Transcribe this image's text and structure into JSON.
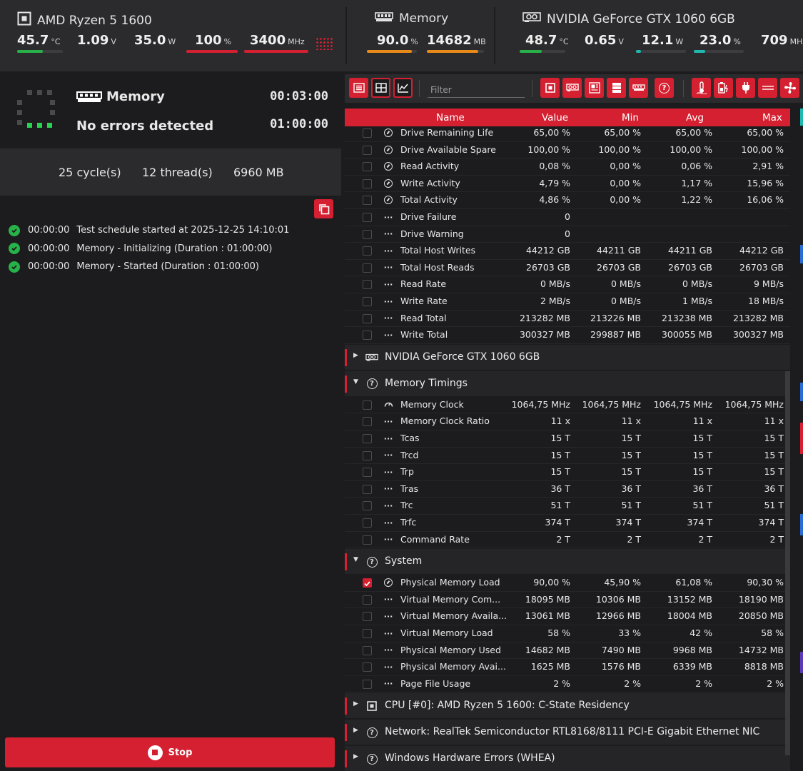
{
  "topbar": {
    "cpu": {
      "title": "AMD Ryzen 5 1600",
      "metrics": [
        {
          "value": "45.7",
          "unit": "°C",
          "fill": 0.57,
          "color": "#27b249"
        },
        {
          "value": "1.09",
          "unit": "V"
        },
        {
          "value": "35.0",
          "unit": "W"
        },
        {
          "value": "100",
          "unit": "%",
          "fill": 1.0,
          "color": "#d42030"
        },
        {
          "value": "3400",
          "unit": "MHz",
          "fill": 1.0,
          "color": "#d42030"
        }
      ]
    },
    "memory": {
      "title": "Memory",
      "metrics": [
        {
          "value": "90.0",
          "unit": "%",
          "fill": 0.9,
          "color": "#e88a1a"
        },
        {
          "value": "14682",
          "unit": "MB",
          "fill": 0.9,
          "color": "#e88a1a"
        }
      ]
    },
    "gpu": {
      "title": "NVIDIA GeForce GTX 1060 6GB",
      "metrics": [
        {
          "value": "48.7",
          "unit": "°C",
          "fill": 0.49,
          "color": "#27b249"
        },
        {
          "value": "0.65",
          "unit": "V"
        },
        {
          "value": "12.1",
          "unit": "W",
          "fill": 0.1,
          "color": "#1fb8b0"
        },
        {
          "value": "23.0",
          "unit": "%",
          "fill": 0.23,
          "color": "#1fb8b0"
        },
        {
          "value": "709",
          "unit": "MHz"
        }
      ]
    }
  },
  "status": {
    "title": "Memory",
    "subtitle": "No errors detected",
    "elapsed": "00:03:00",
    "duration": "01:00:00"
  },
  "summary": {
    "cycles": "25 cycle(s)",
    "threads": "12 thread(s)",
    "memory": "6960 MB"
  },
  "log": [
    {
      "time": "00:00:00",
      "text": "Test schedule started at 2025-12-25 14:10:01"
    },
    {
      "time": "00:00:00",
      "text": "Memory - Initializing (Duration : 01:00:00)"
    },
    {
      "time": "00:00:00",
      "text": "Memory - Started (Duration : 01:00:00)"
    }
  ],
  "stop_label": "Stop",
  "toolbar": {
    "filter_placeholder": "Filter"
  },
  "columns": {
    "name": "Name",
    "value": "Value",
    "min": "Min",
    "avg": "Avg",
    "max": "Max"
  },
  "grid": [
    {
      "type": "row",
      "icon": "gauge",
      "name": "Drive Remaining Life",
      "value": "65,00 %",
      "min": "65,00 %",
      "avg": "65,00 %",
      "max": "65,00 %"
    },
    {
      "type": "row",
      "icon": "gauge",
      "name": "Drive Available Spare",
      "value": "100,00 %",
      "min": "100,00 %",
      "avg": "100,00 %",
      "max": "100,00 %"
    },
    {
      "type": "row",
      "icon": "gauge",
      "name": "Read Activity",
      "value": "0,08 %",
      "min": "0,00 %",
      "avg": "0,06 %",
      "max": "2,91 %"
    },
    {
      "type": "row",
      "icon": "gauge",
      "name": "Write Activity",
      "value": "4,79 %",
      "min": "0,00 %",
      "avg": "1,17 %",
      "max": "15,96 %"
    },
    {
      "type": "row",
      "icon": "gauge",
      "name": "Total Activity",
      "value": "4,86 %",
      "min": "0,00 %",
      "avg": "1,22 %",
      "max": "16,06 %"
    },
    {
      "type": "row",
      "icon": "dots",
      "name": "Drive Failure",
      "value": "0",
      "min": "",
      "avg": "",
      "max": ""
    },
    {
      "type": "row",
      "icon": "dots",
      "name": "Drive Warning",
      "value": "0",
      "min": "",
      "avg": "",
      "max": ""
    },
    {
      "type": "row",
      "icon": "dots",
      "name": "Total Host Writes",
      "value": "44212 GB",
      "min": "44211 GB",
      "avg": "44211 GB",
      "max": "44212 GB"
    },
    {
      "type": "row",
      "icon": "dots",
      "name": "Total Host Reads",
      "value": "26703 GB",
      "min": "26703 GB",
      "avg": "26703 GB",
      "max": "26703 GB"
    },
    {
      "type": "row",
      "icon": "dots",
      "name": "Read Rate",
      "value": "0 MB/s",
      "min": "0 MB/s",
      "avg": "0 MB/s",
      "max": "9 MB/s"
    },
    {
      "type": "row",
      "icon": "dots",
      "name": "Write Rate",
      "value": "2 MB/s",
      "min": "0 MB/s",
      "avg": "1 MB/s",
      "max": "18 MB/s"
    },
    {
      "type": "row",
      "icon": "dots",
      "name": "Read Total",
      "value": "213282 MB",
      "min": "213226 MB",
      "avg": "213238 MB",
      "max": "213282 MB"
    },
    {
      "type": "row",
      "icon": "dots",
      "name": "Write Total",
      "value": "300327 MB",
      "min": "299887 MB",
      "avg": "300055 MB",
      "max": "300327 MB"
    },
    {
      "type": "group",
      "icon": "gpu",
      "name": "NVIDIA GeForce GTX 1060 6GB",
      "expanded": false
    },
    {
      "type": "group",
      "icon": "question",
      "name": "Memory Timings",
      "expanded": true
    },
    {
      "type": "row",
      "icon": "speed",
      "name": "Memory Clock",
      "value": "1064,75 MHz",
      "min": "1064,75 MHz",
      "avg": "1064,75 MHz",
      "max": "1064,75 MHz"
    },
    {
      "type": "row",
      "icon": "dots",
      "name": "Memory Clock Ratio",
      "value": "11 x",
      "min": "11 x",
      "avg": "11 x",
      "max": "11 x"
    },
    {
      "type": "row",
      "icon": "dots",
      "name": "Tcas",
      "value": "15 T",
      "min": "15 T",
      "avg": "15 T",
      "max": "15 T"
    },
    {
      "type": "row",
      "icon": "dots",
      "name": "Trcd",
      "value": "15 T",
      "min": "15 T",
      "avg": "15 T",
      "max": "15 T"
    },
    {
      "type": "row",
      "icon": "dots",
      "name": "Trp",
      "value": "15 T",
      "min": "15 T",
      "avg": "15 T",
      "max": "15 T"
    },
    {
      "type": "row",
      "icon": "dots",
      "name": "Tras",
      "value": "36 T",
      "min": "36 T",
      "avg": "36 T",
      "max": "36 T"
    },
    {
      "type": "row",
      "icon": "dots",
      "name": "Trc",
      "value": "51 T",
      "min": "51 T",
      "avg": "51 T",
      "max": "51 T"
    },
    {
      "type": "row",
      "icon": "dots",
      "name": "Trfc",
      "value": "374 T",
      "min": "374 T",
      "avg": "374 T",
      "max": "374 T"
    },
    {
      "type": "row",
      "icon": "dots",
      "name": "Command Rate",
      "value": "2 T",
      "min": "2 T",
      "avg": "2 T",
      "max": "2 T"
    },
    {
      "type": "group",
      "icon": "question",
      "name": "System",
      "expanded": true
    },
    {
      "type": "row",
      "icon": "gauge",
      "name": "Physical Memory Load",
      "value": "90,00 %",
      "min": "45,90 %",
      "avg": "61,08 %",
      "max": "90,30 %",
      "checked": true
    },
    {
      "type": "row",
      "icon": "dots",
      "name": "Virtual Memory Com...",
      "value": "18095 MB",
      "min": "10306 MB",
      "avg": "13152 MB",
      "max": "18190 MB"
    },
    {
      "type": "row",
      "icon": "dots",
      "name": "Virtual Memory Availa...",
      "value": "13061 MB",
      "min": "12966 MB",
      "avg": "18004 MB",
      "max": "20850 MB"
    },
    {
      "type": "row",
      "icon": "dots",
      "name": "Virtual Memory Load",
      "value": "58 %",
      "min": "33 %",
      "avg": "42 %",
      "max": "58 %"
    },
    {
      "type": "row",
      "icon": "dots",
      "name": "Physical Memory Used",
      "value": "14682 MB",
      "min": "7490 MB",
      "avg": "9968 MB",
      "max": "14732 MB"
    },
    {
      "type": "row",
      "icon": "dots",
      "name": "Physical Memory Avai...",
      "value": "1625 MB",
      "min": "1576 MB",
      "avg": "6339 MB",
      "max": "8818 MB"
    },
    {
      "type": "row",
      "icon": "dots",
      "name": "Page File Usage",
      "value": "2 %",
      "min": "2 %",
      "avg": "2 %",
      "max": "2 %"
    },
    {
      "type": "group",
      "icon": "cpu",
      "name": "CPU [#0]: AMD Ryzen 5 1600: C-State Residency",
      "expanded": false
    },
    {
      "type": "group",
      "icon": "question",
      "name": "Network: RealTek Semiconductor RTL8168/8111 PCI-E Gigabit Ethernet NIC",
      "expanded": false
    },
    {
      "type": "group",
      "icon": "question",
      "name": "Windows Hardware Errors (WHEA)",
      "expanded": false
    }
  ]
}
